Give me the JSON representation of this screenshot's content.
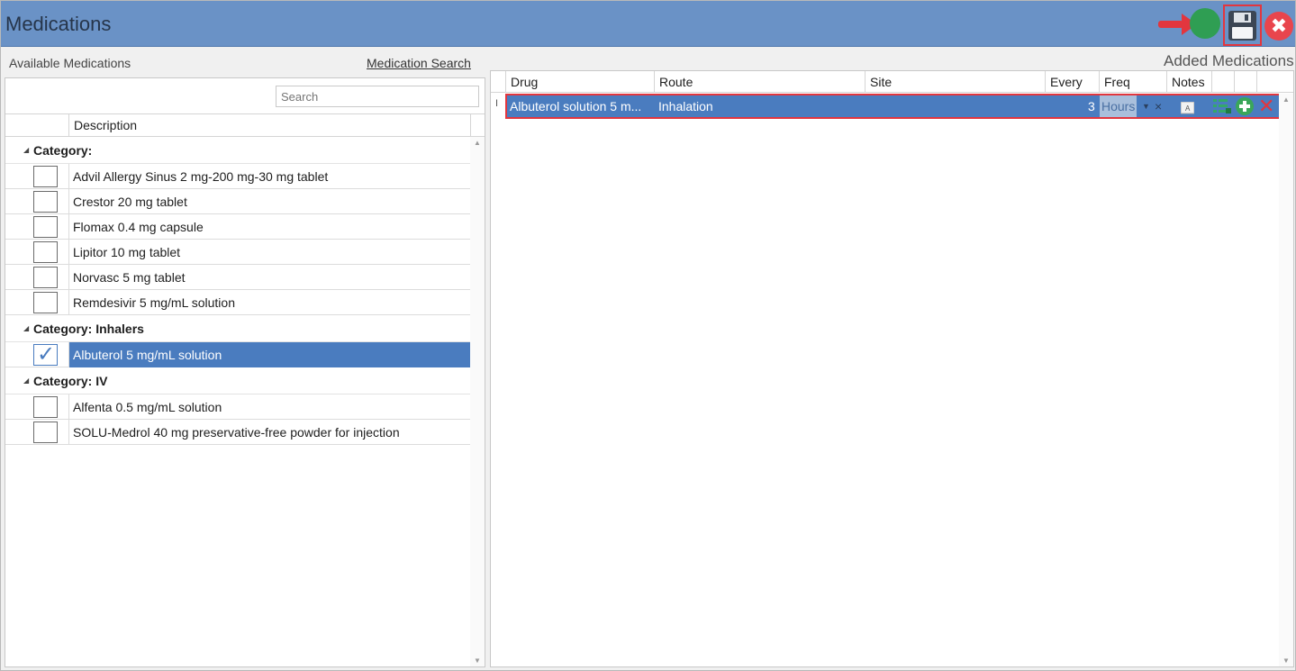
{
  "window": {
    "title": "Medications",
    "colors": {
      "header": "#6a92c6",
      "selection": "#4a7cbf",
      "highlight": "#e2363e"
    }
  },
  "left": {
    "heading": "Available Medications",
    "search_link": "Medication Search",
    "search_placeholder": "Search",
    "column_description": "Description",
    "groups": [
      {
        "category": "Category:",
        "items": [
          {
            "label": "Advil Allergy Sinus 2 mg-200 mg-30 mg tablet",
            "checked": false
          },
          {
            "label": "Crestor 20 mg tablet",
            "checked": false
          },
          {
            "label": "Flomax 0.4 mg capsule",
            "checked": false
          },
          {
            "label": "Lipitor 10 mg tablet",
            "checked": false
          },
          {
            "label": "Norvasc 5 mg tablet",
            "checked": false
          },
          {
            "label": "Remdesivir 5 mg/mL solution",
            "checked": false
          }
        ]
      },
      {
        "category": "Category: Inhalers",
        "items": [
          {
            "label": "Albuterol 5 mg/mL solution",
            "checked": true
          }
        ]
      },
      {
        "category": "Category: IV",
        "items": [
          {
            "label": "Alfenta 0.5 mg/mL solution",
            "checked": false
          },
          {
            "label": "SOLU-Medrol 40 mg preservative-free powder for injection",
            "checked": false
          }
        ]
      }
    ]
  },
  "right": {
    "heading": "Added Medications",
    "columns": {
      "drug": "Drug",
      "route": "Route",
      "site": "Site",
      "every": "Every",
      "freq": "Freq",
      "notes": "Notes"
    },
    "row": {
      "drug": "Albuterol solution 5 m...",
      "route": "Inhalation",
      "site": "",
      "every": "3",
      "freq": "Hours"
    }
  },
  "icons": {
    "save": "save-icon",
    "close": "close-icon",
    "arrow": "red-arrow-icon",
    "notes": "notes-icon",
    "details": "details-icon",
    "add": "add-icon",
    "remove": "remove-icon"
  }
}
